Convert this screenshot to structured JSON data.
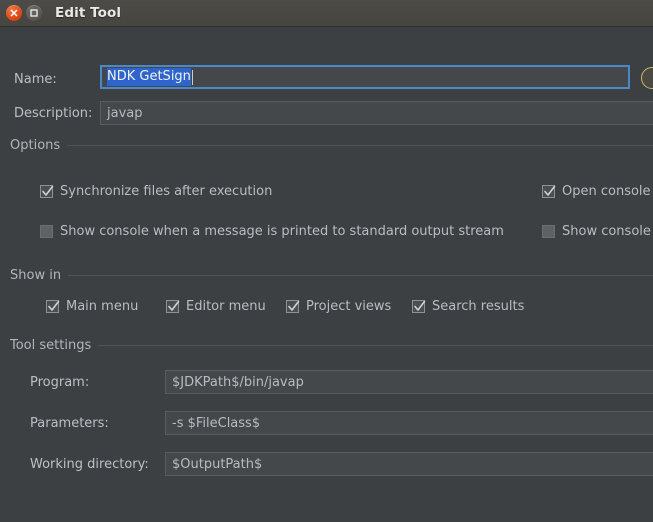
{
  "window": {
    "title": "Edit Tool",
    "close_button_label": "Close",
    "maximize_button_label": "Maximize",
    "close_icon": "close-x-icon",
    "maximize_icon": "maximize-square-icon"
  },
  "colors": {
    "dialog_background": "#3c4043",
    "titlebar_background": "#47453f",
    "field_background": "#45484a",
    "field_border": "#5a5d60",
    "focus_border": "#4a88c7",
    "selection_background": "#2f65ca",
    "text": "#b8bcc0",
    "separator": "#4e5255",
    "close_button": "#dd4814"
  },
  "form": {
    "name": {
      "label": "Name:",
      "value": "NDK GetSign",
      "placeholder": "",
      "selected": true,
      "focused": true
    },
    "description": {
      "label": "Description:",
      "value": "javap",
      "placeholder": ""
    }
  },
  "options": {
    "group_label": "Options",
    "items": [
      {
        "label": "Synchronize files after execution",
        "checked": true,
        "column": "left",
        "row": 0
      },
      {
        "label": "Open console",
        "checked": true,
        "column": "right",
        "row": 0,
        "clipped": true
      },
      {
        "label": "Show console when a message is printed to standard output stream",
        "checked": false,
        "column": "left",
        "row": 1
      },
      {
        "label": "Show console",
        "checked": false,
        "column": "right",
        "row": 1,
        "clipped": true
      }
    ]
  },
  "show_in": {
    "group_label": "Show in",
    "items": [
      {
        "label": "Main menu",
        "checked": true
      },
      {
        "label": "Editor menu",
        "checked": true
      },
      {
        "label": "Project views",
        "checked": true
      },
      {
        "label": "Search results",
        "checked": true
      }
    ]
  },
  "tool_settings": {
    "group_label": "Tool settings",
    "fields": [
      {
        "label": "Program:",
        "value": "$JDKPath$/bin/javap"
      },
      {
        "label": "Parameters:",
        "value": "-s $FileClass$"
      },
      {
        "label": "Working directory:",
        "value": "$OutputPath$"
      }
    ]
  }
}
